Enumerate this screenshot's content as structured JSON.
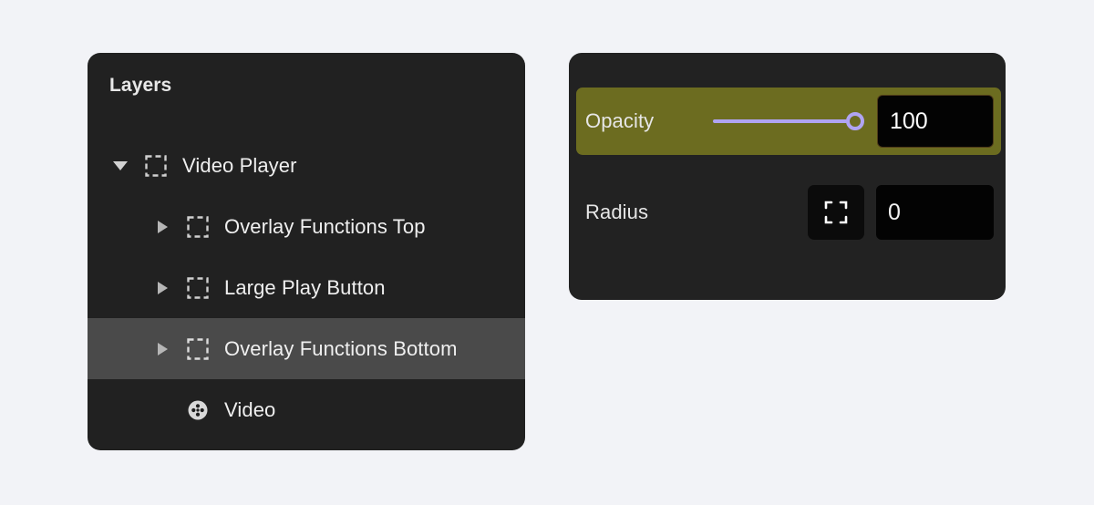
{
  "colors": {
    "app_background": "#f2f3f7",
    "panel_background": "#212121",
    "selected_row": "#4a4a4a",
    "highlight_olive": "#6c6c20",
    "slider_accent": "#b0a4f2",
    "value_field": "#030303",
    "text_primary": "#efefef"
  },
  "layers_panel": {
    "title": "Layers",
    "rows": [
      {
        "label": "Video Player",
        "icon": "dashed-frame-icon",
        "disclosure": "expanded",
        "indent": 0,
        "selected": false
      },
      {
        "label": "Overlay Functions Top",
        "icon": "dashed-frame-icon",
        "disclosure": "collapsed",
        "indent": 1,
        "selected": false
      },
      {
        "label": "Large Play Button",
        "icon": "dashed-frame-icon",
        "disclosure": "collapsed",
        "indent": 1,
        "selected": false
      },
      {
        "label": "Overlay Functions Bottom",
        "icon": "dashed-frame-icon",
        "disclosure": "collapsed",
        "indent": 1,
        "selected": true
      },
      {
        "label": "Video",
        "icon": "film-reel-icon",
        "disclosure": "none",
        "indent": 1,
        "selected": false
      }
    ]
  },
  "properties_panel": {
    "opacity": {
      "label": "Opacity",
      "value": "100",
      "slider_percent": 100,
      "highlighted": true
    },
    "radius": {
      "label": "Radius",
      "value": "0",
      "corner_button_icon": "independent-corners-icon"
    }
  }
}
